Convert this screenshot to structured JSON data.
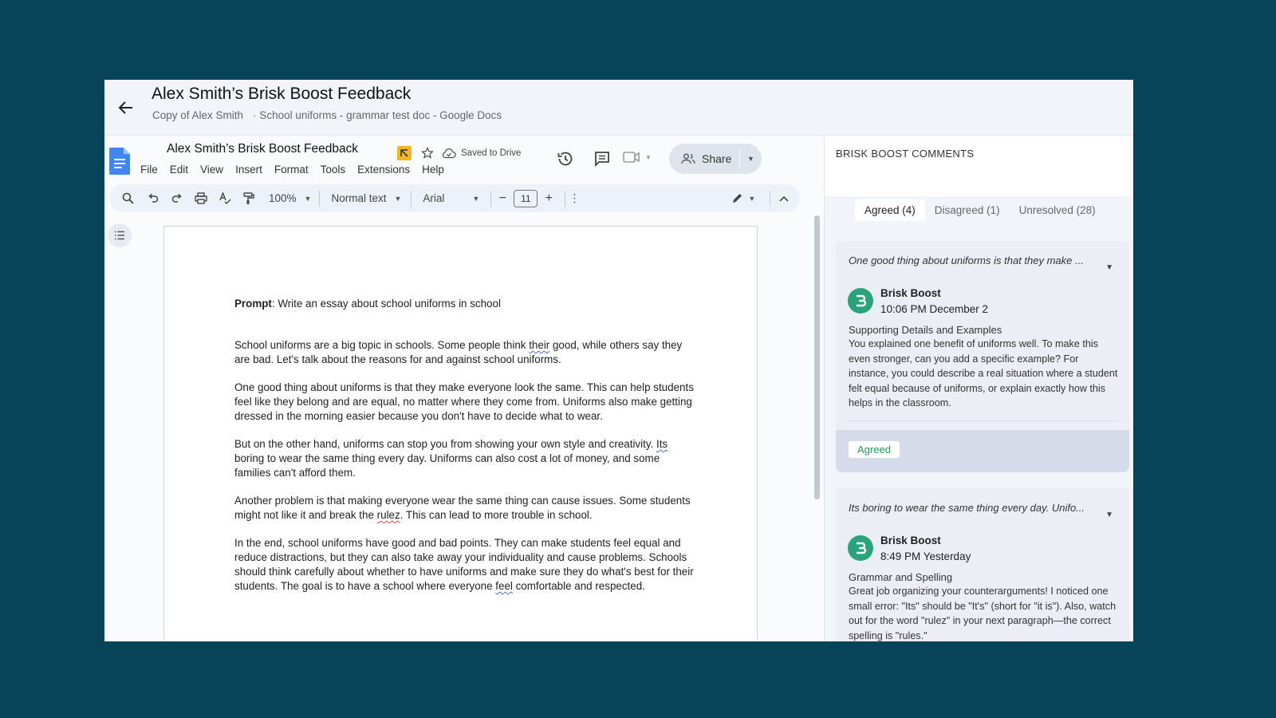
{
  "header": {
    "title": "Alex Smith’s Brisk Boost Feedback",
    "subtitle_left": "Copy of Alex Smith",
    "subtitle_right": "· School uniforms - grammar test doc - Google Docs"
  },
  "docs": {
    "doc_name": "Alex Smith’s Brisk Boost Feedback",
    "saved_status": "Saved to Drive",
    "menu": [
      "File",
      "Edit",
      "View",
      "Insert",
      "Format",
      "Tools",
      "Extensions",
      "Help"
    ],
    "share_label": "Share",
    "toolbar": {
      "zoom": "100%",
      "style": "Normal text",
      "font": "Arial",
      "font_size": "11"
    }
  },
  "document": {
    "prompt_label": "Prompt",
    "prompt_text": ": Write an essay about school uniforms in school",
    "p1_a": "School uniforms are a big topic in schools. Some people think ",
    "p1_err": "their",
    "p1_b": " good, while others say they are bad. Let's talk about the reasons for and against school uniforms.",
    "p2": "One good thing about uniforms is that they make everyone look the same. This can help students feel like they belong and are equal, no matter where they come from. Uniforms also make getting dressed in the morning easier because you don't have to decide what to wear.",
    "p3_a": "But on the other hand, uniforms can stop you from showing your own style and creativity. ",
    "p3_err": "Its",
    "p3_b": " boring to wear the same thing every day. Uniforms can also cost a lot of money, and some families can't afford them.",
    "p4_a": "Another problem is that making everyone wear the same thing can cause issues. Some students might not like it and break the ",
    "p4_err": "rulez",
    "p4_b": ". This can lead to more trouble in school.",
    "p5_a": "In the end, school uniforms have good and bad points. They can make students feel equal and reduce distractions, but they can also take away your individuality and cause problems. Schools should think carefully about whether to have uniforms and make sure they do what's best for their students. The goal is to have a school where everyone ",
    "p5_err": "feel",
    "p5_b": " comfortable and respected."
  },
  "panel": {
    "title": "BRISK BOOST COMMENTS",
    "tabs": [
      "Agreed (4)",
      "Disagreed (1)",
      "Unresolved (28)"
    ],
    "comments": [
      {
        "quote": "One good thing about uniforms is that they make ...",
        "author": "Brisk Boost",
        "time": "10:06 PM December 2",
        "category": "Supporting Details and Examples",
        "body": "You explained one benefit of uniforms well. To make this even stronger, can you add a specific example? For instance, you could describe a real situation where a student felt equal because of uniforms, or explain exactly how this helps in the classroom.",
        "status": "Agreed"
      },
      {
        "quote": "Its boring to wear the same thing every day. Unifo...",
        "author": "Brisk Boost",
        "time": "8:49 PM Yesterday",
        "category": "Grammar and Spelling",
        "body": "Great job organizing your counterarguments! I noticed one small error: \"Its\" should be \"It's\" (short for \"it is\"). Also, watch out for the word \"rulez\" in your next paragraph—the correct spelling is \"rules.\""
      }
    ]
  },
  "colors": {
    "background": "#07445a",
    "brisk_green": "#2aa27a",
    "agreed_green": "#239b5c",
    "docs_blue": "#4285f4"
  }
}
